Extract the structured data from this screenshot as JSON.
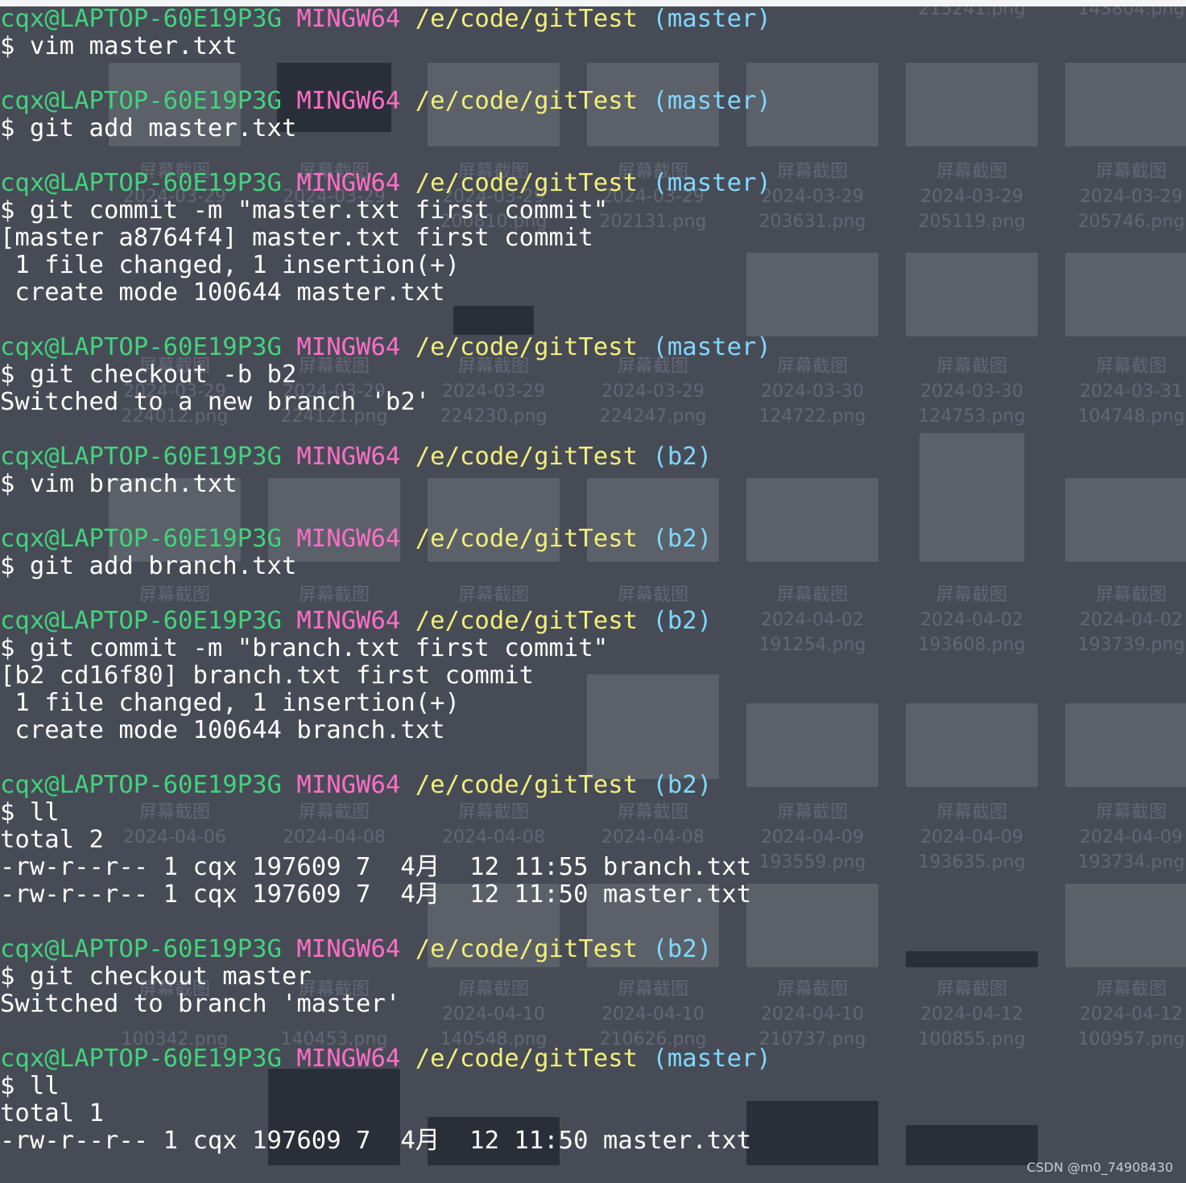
{
  "prompt": {
    "user_host": "cqx@LAPTOP-60E19P3G",
    "system": "MINGW64",
    "path": "/e/code/gitTest",
    "sign": "$"
  },
  "blocks": [
    {
      "branch": "(master)",
      "command": "vim master.txt",
      "output": []
    },
    {
      "branch": "(master)",
      "command": "git add master.txt",
      "output": []
    },
    {
      "branch": "(master)",
      "command": "git commit -m \"master.txt first commit\"",
      "output": [
        "[master a8764f4] master.txt first commit",
        " 1 file changed, 1 insertion(+)",
        " create mode 100644 master.txt"
      ]
    },
    {
      "branch": "(master)",
      "command": "git checkout -b b2",
      "output": [
        "Switched to a new branch 'b2'"
      ]
    },
    {
      "branch": "(b2)",
      "command": "vim branch.txt",
      "output": []
    },
    {
      "branch": "(b2)",
      "command": "git add branch.txt",
      "output": []
    },
    {
      "branch": "(b2)",
      "command": "git commit -m \"branch.txt first commit\"",
      "output": [
        "[b2 cd16f80] branch.txt first commit",
        " 1 file changed, 1 insertion(+)",
        " create mode 100644 branch.txt"
      ]
    },
    {
      "branch": "(b2)",
      "command": "ll",
      "output": [
        "total 2",
        "-rw-r--r-- 1 cqx 197609 7  4月  12 11:55 branch.txt",
        "-rw-r--r-- 1 cqx 197609 7  4月  12 11:50 master.txt"
      ]
    },
    {
      "branch": "(b2)",
      "command": "git checkout master",
      "output": [
        "Switched to branch 'master'"
      ]
    },
    {
      "branch": "(master)",
      "command": "ll",
      "output": [
        "total 1",
        "-rw-r--r-- 1 cqx 197609 7  4月  12 11:50 master.txt"
      ]
    }
  ],
  "background_files": [
    [
      "",
      "",
      "",
      "",
      "",
      "215241.png",
      "143804.png"
    ],
    [
      "屏幕截图\n2024-03-29\n",
      "屏幕截图\n2024-03-29\n",
      "屏幕截图\n2024-03-29\n200810.png",
      "屏幕截图\n2024-03-29\n202131.png",
      "屏幕截图\n2024-03-29\n203631.png",
      "屏幕截图\n2024-03-29\n205119.png",
      "屏幕截图\n2024-03-29\n205746.png"
    ],
    [
      "屏幕截图\n2024-03-29\n224012.png",
      "屏幕截图\n2024-03-29\n224121.png",
      "屏幕截图\n2024-03-29\n224230.png",
      "屏幕截图\n2024-03-29\n224247.png",
      "屏幕截图\n2024-03-30\n124722.png",
      "屏幕截图\n2024-03-30\n124753.png",
      "屏幕截图\n2024-03-31\n104748.png"
    ],
    [
      "屏幕截图\n\n",
      "屏幕截图\n\n",
      "屏幕截图\n\n",
      "屏幕截图\n\n",
      "屏幕截图\n2024-04-02\n191254.png",
      "屏幕截图\n2024-04-02\n193608.png",
      "屏幕截图\n2024-04-02\n193739.png"
    ],
    [
      "屏幕截图\n2024-04-06\n",
      "屏幕截图\n2024-04-08\n",
      "屏幕截图\n2024-04-08\n",
      "屏幕截图\n2024-04-08\n",
      "屏幕截图\n2024-04-09\n193559.png",
      "屏幕截图\n2024-04-09\n193635.png",
      "屏幕截图\n2024-04-09\n193734.png"
    ],
    [
      "屏幕截图\n\n100342.png",
      "屏幕截图\n\n140453.png",
      "屏幕截图\n2024-04-10\n140548.png",
      "屏幕截图\n2024-04-10\n210626.png",
      "屏幕截图\n2024-04-10\n210737.png",
      "屏幕截图\n2024-04-12\n100855.png",
      "屏幕截图\n2024-04-12\n100957.png"
    ]
  ],
  "watermark": "CSDN @m0_74908430"
}
